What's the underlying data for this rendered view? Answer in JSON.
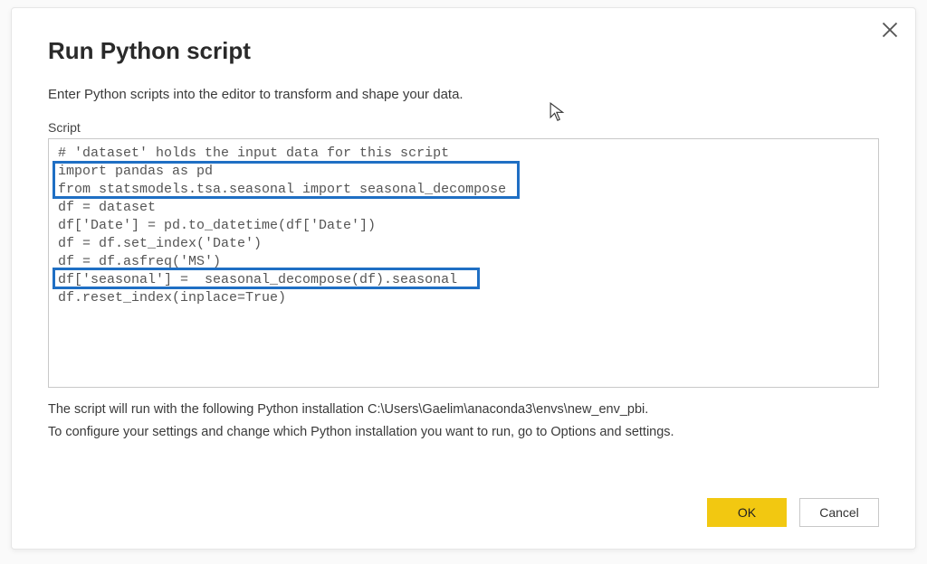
{
  "dialog": {
    "title": "Run Python script",
    "subtitle": "Enter Python scripts into the editor to transform and shape your data.",
    "field_label": "Script",
    "info_line1": "The script will run with the following Python installation C:\\Users\\Gaelim\\anaconda3\\envs\\new_env_pbi.",
    "info_line2": "To configure your settings and change which Python installation you want to run, go to Options and settings."
  },
  "script": {
    "lines": [
      "# 'dataset' holds the input data for this script",
      "import pandas as pd",
      "from statsmodels.tsa.seasonal import seasonal_decompose",
      "df = dataset",
      "df['Date'] = pd.to_datetime(df['Date'])",
      "df = df.set_index('Date')",
      "df = df.asfreq('MS')",
      "df['seasonal'] =  seasonal_decompose(df).seasonal",
      "df.reset_index(inplace=True)"
    ]
  },
  "buttons": {
    "ok": "OK",
    "cancel": "Cancel"
  }
}
